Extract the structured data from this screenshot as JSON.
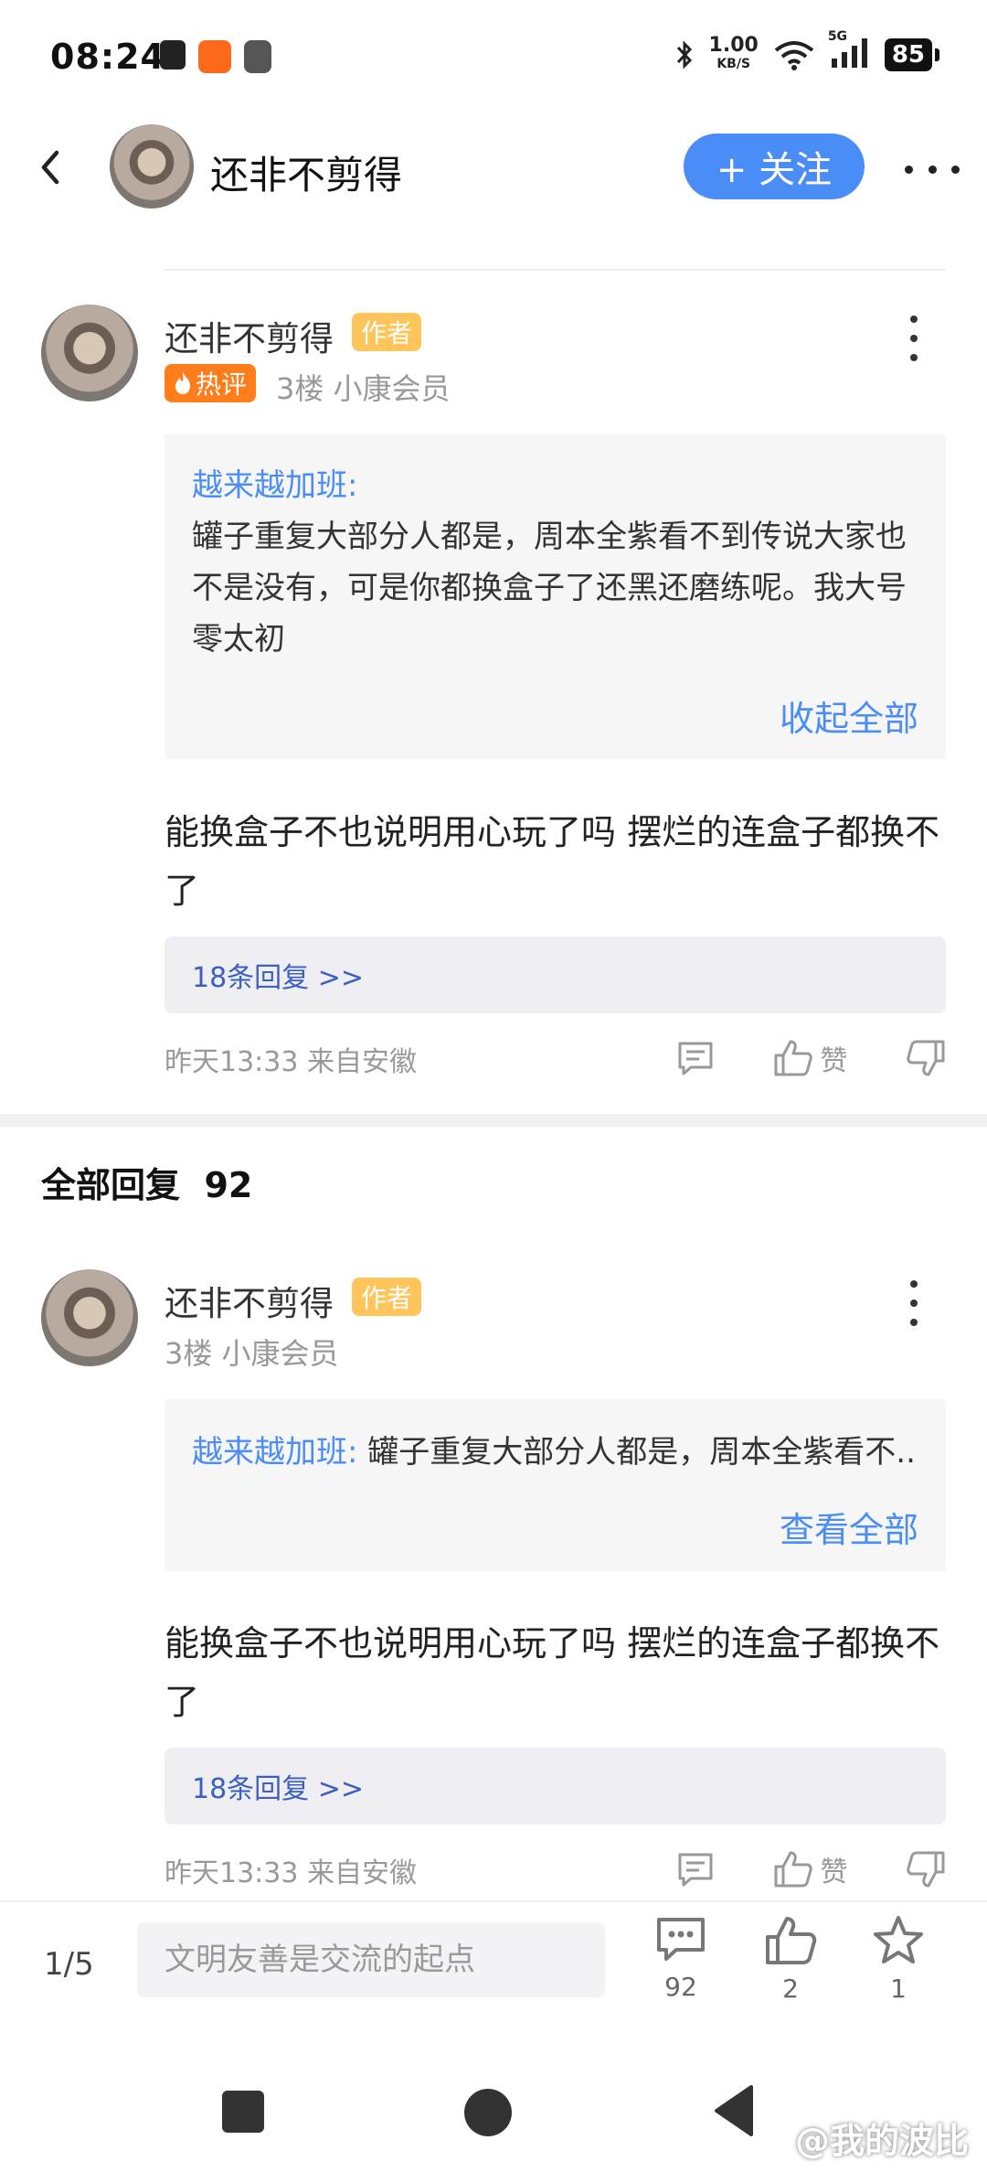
{
  "status_bar": {
    "time": "08:24",
    "net_speed_value": "1.00",
    "net_speed_unit": "KB/S",
    "network": "5G",
    "battery": "85"
  },
  "header": {
    "title": "还非不剪得",
    "follow_label": "+ 关注"
  },
  "main_comment": {
    "author": "还非不剪得",
    "author_tag": "作者",
    "hot_tag": "热评",
    "meta": "3楼 小康会员",
    "quote_user": "越来越加班:",
    "quote_text": "罐子重复大部分人都是，周本全紫看不到传说大家也不是没有，可是你都换盒子了还黑还磨练呢。我大号零太初",
    "quote_toggle": "收起全部",
    "body": "能换盒子不也说明用心玩了吗 摆烂的连盒子都换不了",
    "replies_link": "18条回复 >>",
    "time": "昨天13:33 来自安徽",
    "like_label": "赞"
  },
  "all_replies": {
    "label": "全部回复",
    "count": "92"
  },
  "reply_comment": {
    "author": "还非不剪得",
    "author_tag": "作者",
    "meta": "3楼 小康会员",
    "quote_user": "越来越加班:",
    "quote_text": "罐子重复大部分人都是，周本全紫看不...",
    "quote_toggle": "查看全部",
    "body": "能换盒子不也说明用心玩了吗 摆烂的连盒子都换不了",
    "replies_link": "18条回复 >>",
    "time": "昨天13:33 来自安徽",
    "like_label": "赞"
  },
  "bottom_bar": {
    "page_indicator": "1/5",
    "input_placeholder": "文明友善是交流的起点",
    "comment_count": "92",
    "like_count": "2",
    "fav_count": "1"
  },
  "watermark": "@我的波比",
  "colors": {
    "accent": "#4a8df7",
    "author_tag": "#ffc55a",
    "hot_tag": "#ff7d1a",
    "reply_link": "#3b5fc0"
  }
}
